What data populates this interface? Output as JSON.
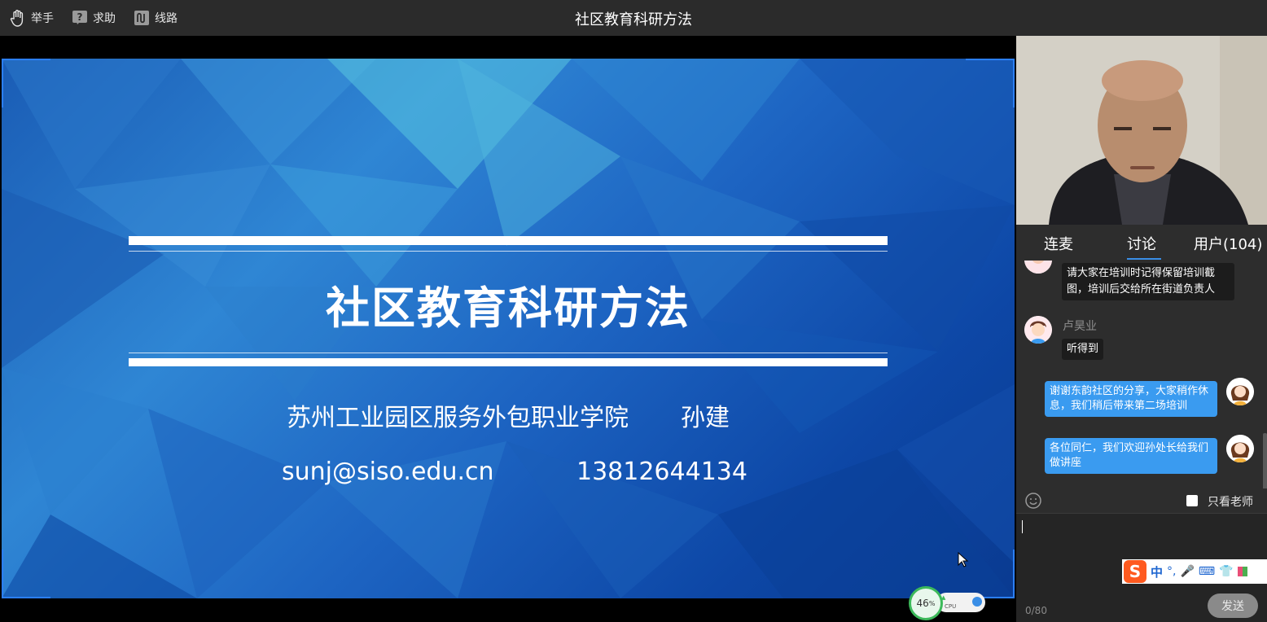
{
  "topbar": {
    "raise_hand": "举手",
    "help": "求助",
    "route": "线路",
    "title": "社区教育科研方法"
  },
  "slide": {
    "title": "社区教育科研方法",
    "institution": "苏州工业园区服务外包职业学院",
    "presenter": "孙建",
    "email": "sunj@siso.edu.cn",
    "phone": "13812644134"
  },
  "cpu_widget": {
    "percent": "46",
    "percent_unit": "%",
    "label": "CPU"
  },
  "panel": {
    "tabs": [
      "连麦",
      "讨论",
      "用户(104)"
    ],
    "active_tab": "讨论",
    "messages": [
      {
        "side": "left",
        "user": "",
        "text": "请大家在培训时记得保留培训截图，培训后交给所在街道负责人"
      },
      {
        "side": "left",
        "user": "卢昊业",
        "text": "听得到"
      },
      {
        "side": "right",
        "user": "",
        "text": "谢谢东韵社区的分享，大家稍作休息，我们稍后带来第二场培训"
      },
      {
        "side": "right",
        "user": "",
        "text": "各位同仁，我们欢迎孙处长给我们做讲座"
      }
    ],
    "teacher_only_label": "只看老师",
    "counter": "0/80",
    "send_label": "发送",
    "ime_label": "中"
  },
  "colors": {
    "accent": "#3a8ee6",
    "bubble_self": "#3a9bf0",
    "panel_bg": "#2d2d2d",
    "topbar_bg": "#2b2b2b"
  }
}
